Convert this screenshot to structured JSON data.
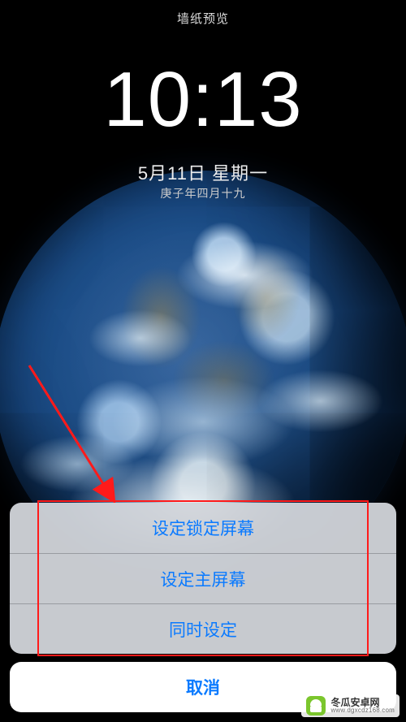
{
  "header": {
    "title": "墙纸预览"
  },
  "lockscreen": {
    "time": "10:13",
    "date": "5月11日 星期一",
    "lunar": "庚子年四月十九"
  },
  "actionsheet": {
    "options": [
      {
        "label": "设定锁定屏幕"
      },
      {
        "label": "设定主屏幕"
      },
      {
        "label": "同时设定"
      }
    ],
    "cancel": "取消"
  },
  "annotation": {
    "arrow_color": "#ff1a1a",
    "highlight_color": "#ff1a1a"
  },
  "watermark": {
    "brand": "冬瓜安卓网",
    "url": "www.dgxcdz168.com"
  }
}
